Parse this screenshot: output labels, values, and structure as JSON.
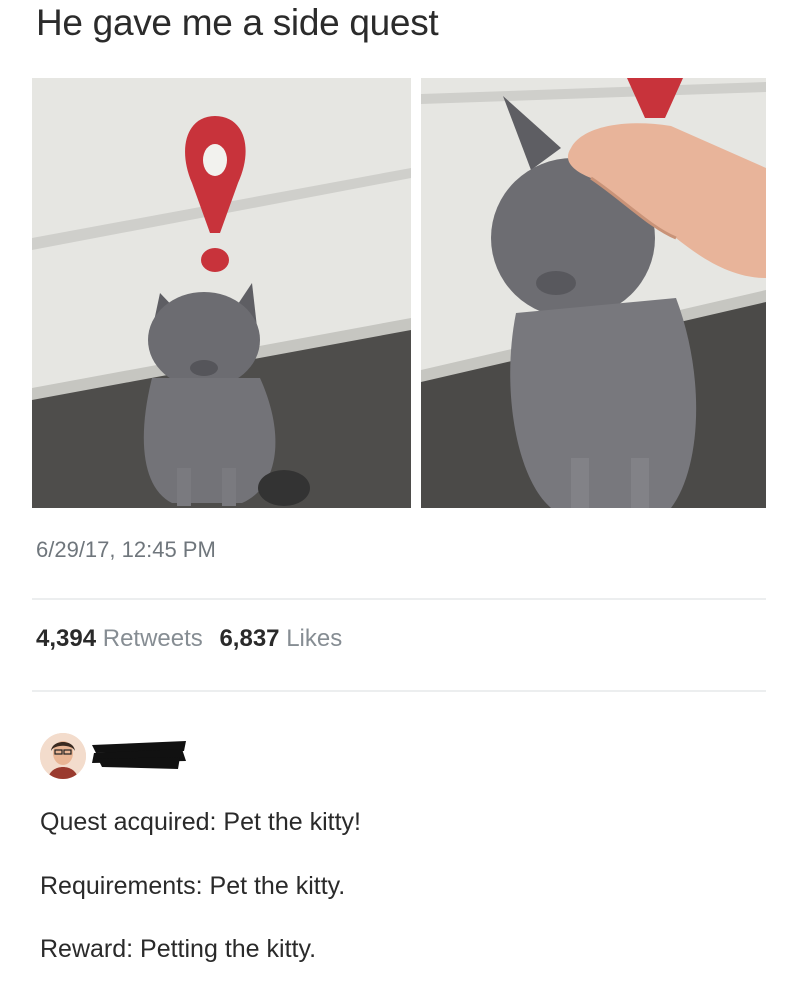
{
  "tweet": {
    "text": "He gave me a side quest",
    "timestamp": "6/29/17, 12:45 PM",
    "retweets_count": "4,394",
    "retweets_label": "Retweets",
    "likes_count": "6,837",
    "likes_label": "Likes"
  },
  "reply": {
    "lines": [
      "Quest acquired: Pet the kitty!",
      "Requirements: Pet the kitty.",
      "Reward: Petting the kitty."
    ]
  },
  "colors": {
    "quest_marker": "#c8333b",
    "cat": "#6e6e73",
    "wall": "#e4e4e0",
    "pavement": "#4b4a48"
  }
}
